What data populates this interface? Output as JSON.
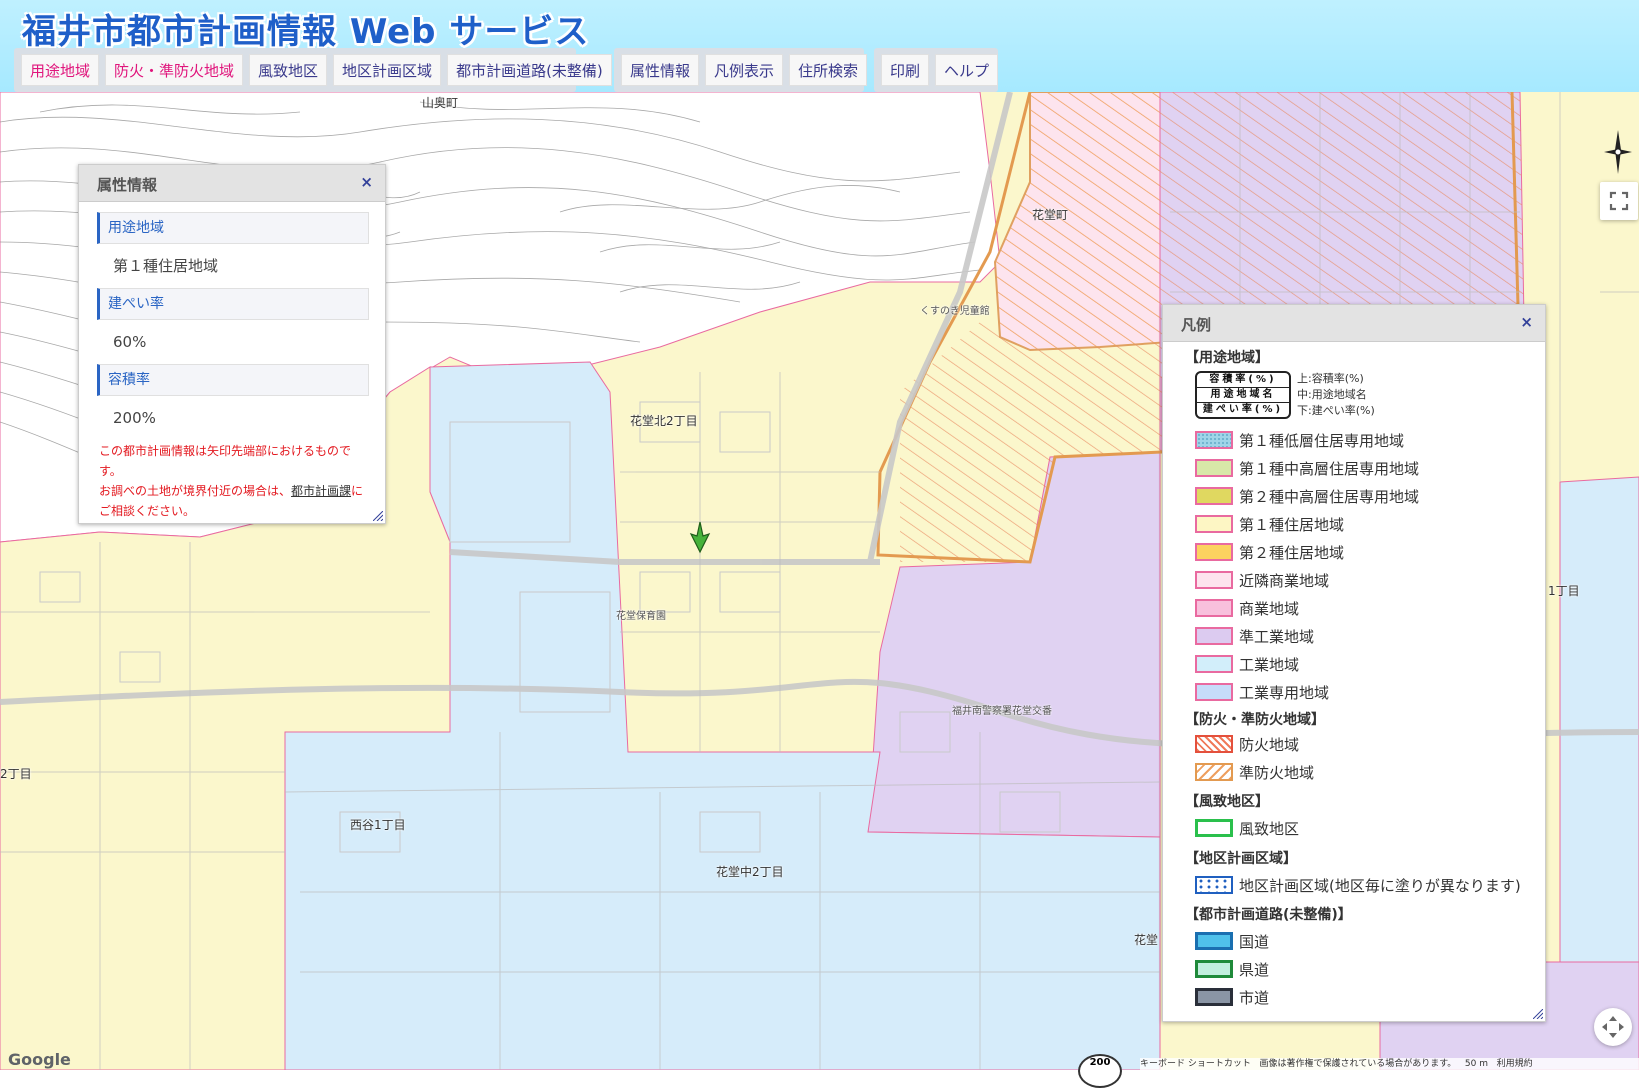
{
  "header": {
    "title": "福井市都市計画情報 Web サービス",
    "menu_group1": [
      "用途地域",
      "防火・準防火地域",
      "風致地区",
      "地区計画区域",
      "都市計画道路(未整備)"
    ],
    "menu_group2": [
      "属性情報",
      "凡例表示",
      "住所検索"
    ],
    "menu_group3": [
      "印刷",
      "ヘルプ"
    ]
  },
  "map": {
    "places": {
      "yamaoku": "山奥町",
      "hanado": "花堂町",
      "kusunoki": "くすのき児童館",
      "hanadokita2": "花堂北2丁目",
      "hanadohoikuen": "花堂保育園",
      "nishitani1": "西谷1丁目",
      "hanadonaka2": "花堂中2丁目",
      "keisatsu": "福井南警察署花堂交番",
      "chome2": "2丁目",
      "chome1": "1丁目",
      "hanado_cut": "花堂"
    },
    "google": "Google",
    "footer": {
      "shortcuts": "キーボード ショートカット",
      "copyright": "画像は著作権で保護されている場合があります。",
      "scale": "50 m",
      "terms": "利用規約"
    },
    "scale_circle": "200"
  },
  "attr_panel": {
    "title": "属性情報",
    "close": "×",
    "rows": [
      {
        "label": "用途地域",
        "value": "第１種住居地域"
      },
      {
        "label": "建ぺい率",
        "value": "60%"
      },
      {
        "label": "容積率",
        "value": "200%"
      }
    ],
    "note1": "この都市計画情報は矢印先端部におけるものです。",
    "note2a": "お調べの土地が境界付近の場合は、",
    "note2link": "都市計画課",
    "note2b": "にご相談ください。"
  },
  "legend": {
    "title": "凡例",
    "close": "×",
    "section_youto": "【用途地域】",
    "explain": {
      "box1": "容積率(%)",
      "box2": "用途地域名",
      "box3": "建ぺい率(%)",
      "t1": "上:容積率(%)",
      "t2": "中:用途地域名",
      "t3": "下:建ぺい率(%)"
    },
    "youto_items": [
      {
        "label": "第１種低層住居専用地域",
        "color": "#9fd5e8"
      },
      {
        "label": "第１種中高層住居専用地域",
        "color": "#d8e8a8"
      },
      {
        "label": "第２種中高層住居専用地域",
        "color": "#e0d860"
      },
      {
        "label": "第１種住居地域",
        "color": "#fdf6c4"
      },
      {
        "label": "第２種住居地域",
        "color": "#fcd260"
      },
      {
        "label": "近隣商業地域",
        "color": "#fde4ee"
      },
      {
        "label": "商業地域",
        "color": "#f8c0dc"
      },
      {
        "label": "準工業地域",
        "color": "#dccbf0"
      },
      {
        "label": "工業地域",
        "color": "#d2eefa"
      },
      {
        "label": "工業専用地域",
        "color": "#c6dcfa"
      }
    ],
    "section_bouka": "【防火・準防火地域】",
    "bouka_items": [
      {
        "label": "防火地域"
      },
      {
        "label": "準防火地域"
      }
    ],
    "section_fuchi": "【風致地区】",
    "fuchi_item": "風致地区",
    "section_chiku": "【地区計画区域】",
    "chiku_item": "地区計画区域(地区毎に塗りが異なります)",
    "section_douro": "【都市計画道路(未整備)】",
    "douro_items": [
      {
        "label": "国道",
        "color": "#4fc1ea"
      },
      {
        "label": "県道",
        "color": "#c2eede"
      },
      {
        "label": "市道",
        "color": "#8a95a5"
      }
    ]
  },
  "colors": {
    "zone_residential1": "#fbf7cc",
    "zone_industrial": "#d6ecfa",
    "zone_semi_industrial": "#e0d2f2",
    "boundary_pink": "#e96aa0",
    "fire_hatch": "#f0a060"
  }
}
